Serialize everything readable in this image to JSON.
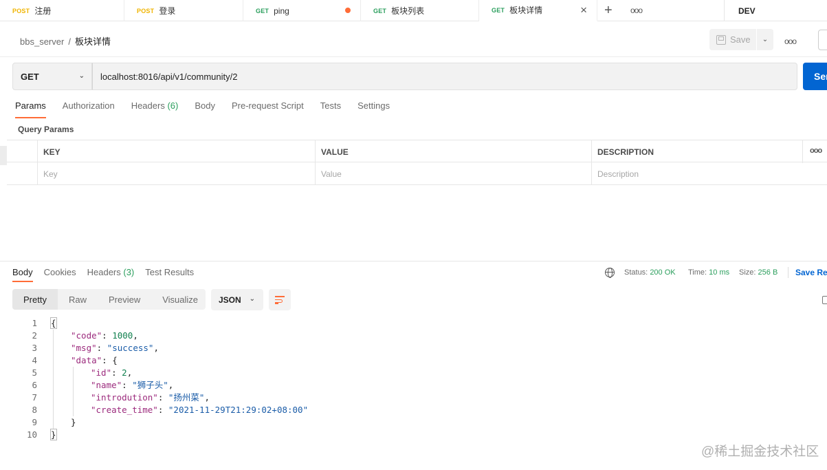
{
  "tabs": [
    {
      "method": "POST",
      "title": "注册"
    },
    {
      "method": "POST",
      "title": "登录"
    },
    {
      "method": "GET",
      "title": "ping"
    },
    {
      "method": "GET",
      "title": "板块列表"
    },
    {
      "method": "GET",
      "title": "板块详情"
    }
  ],
  "tab_close": "×",
  "tab_add": "+",
  "more": "ooo",
  "environment": "DEV",
  "breadcrumb": {
    "collection": "bbs_server",
    "separator": "/",
    "request": "板块详情"
  },
  "toolbar": {
    "save_label": "Save",
    "caret": "⌄"
  },
  "request": {
    "method": "GET",
    "url": "localhost:8016/api/v1/community/2",
    "send_label": "Send"
  },
  "request_tabs": [
    {
      "label": "Params",
      "count": ""
    },
    {
      "label": "Authorization",
      "count": ""
    },
    {
      "label": "Headers",
      "count": "(6)"
    },
    {
      "label": "Body",
      "count": ""
    },
    {
      "label": "Pre-request Script",
      "count": ""
    },
    {
      "label": "Tests",
      "count": ""
    },
    {
      "label": "Settings",
      "count": ""
    }
  ],
  "params": {
    "title": "Query Params",
    "headers": [
      "KEY",
      "VALUE",
      "DESCRIPTION"
    ],
    "placeholders": [
      "Key",
      "Value",
      "Description"
    ]
  },
  "response_tabs": [
    {
      "label": "Body",
      "count": ""
    },
    {
      "label": "Cookies",
      "count": ""
    },
    {
      "label": "Headers",
      "count": "(3)"
    },
    {
      "label": "Test Results",
      "count": ""
    }
  ],
  "status": {
    "status_label": "Status:",
    "status_value": "200 OK",
    "time_label": "Time:",
    "time_value": "10 ms",
    "size_label": "Size:",
    "size_value": "256 B",
    "save_response": "Save Response"
  },
  "view_modes": [
    "Pretty",
    "Raw",
    "Preview",
    "Visualize"
  ],
  "format": "JSON",
  "code_lines": [
    {
      "no": "1",
      "indent": 0,
      "key": "",
      "value": "",
      "vtype": "",
      "text": "{"
    },
    {
      "no": "2",
      "indent": 1,
      "key": "\"code\"",
      "value": "1000",
      "vtype": "n",
      "text": ","
    },
    {
      "no": "3",
      "indent": 1,
      "key": "\"msg\"",
      "value": "\"success\"",
      "vtype": "s",
      "text": ","
    },
    {
      "no": "4",
      "indent": 1,
      "key": "\"data\"",
      "value": "",
      "vtype": "",
      "text": "{"
    },
    {
      "no": "5",
      "indent": 2,
      "key": "\"id\"",
      "value": "2",
      "vtype": "n",
      "text": ","
    },
    {
      "no": "6",
      "indent": 2,
      "key": "\"name\"",
      "value": "\"狮子头\"",
      "vtype": "s",
      "text": ","
    },
    {
      "no": "7",
      "indent": 2,
      "key": "\"introdution\"",
      "value": "\"扬州菜\"",
      "vtype": "s",
      "text": ","
    },
    {
      "no": "8",
      "indent": 2,
      "key": "\"create_time\"",
      "value": "\"2021-11-29T21:29:02+08:00\"",
      "vtype": "s",
      "text": ""
    },
    {
      "no": "9",
      "indent": 1,
      "key": "",
      "value": "",
      "vtype": "",
      "text": "}"
    },
    {
      "no": "10",
      "indent": 0,
      "key": "",
      "value": "",
      "vtype": "",
      "text": "}"
    }
  ],
  "watermark": "@稀土掘金技术社区",
  "colors": {
    "accent": "#ff6c37",
    "primary": "#0265d2",
    "success": "#2a9e5c",
    "post": "#f0b400"
  }
}
